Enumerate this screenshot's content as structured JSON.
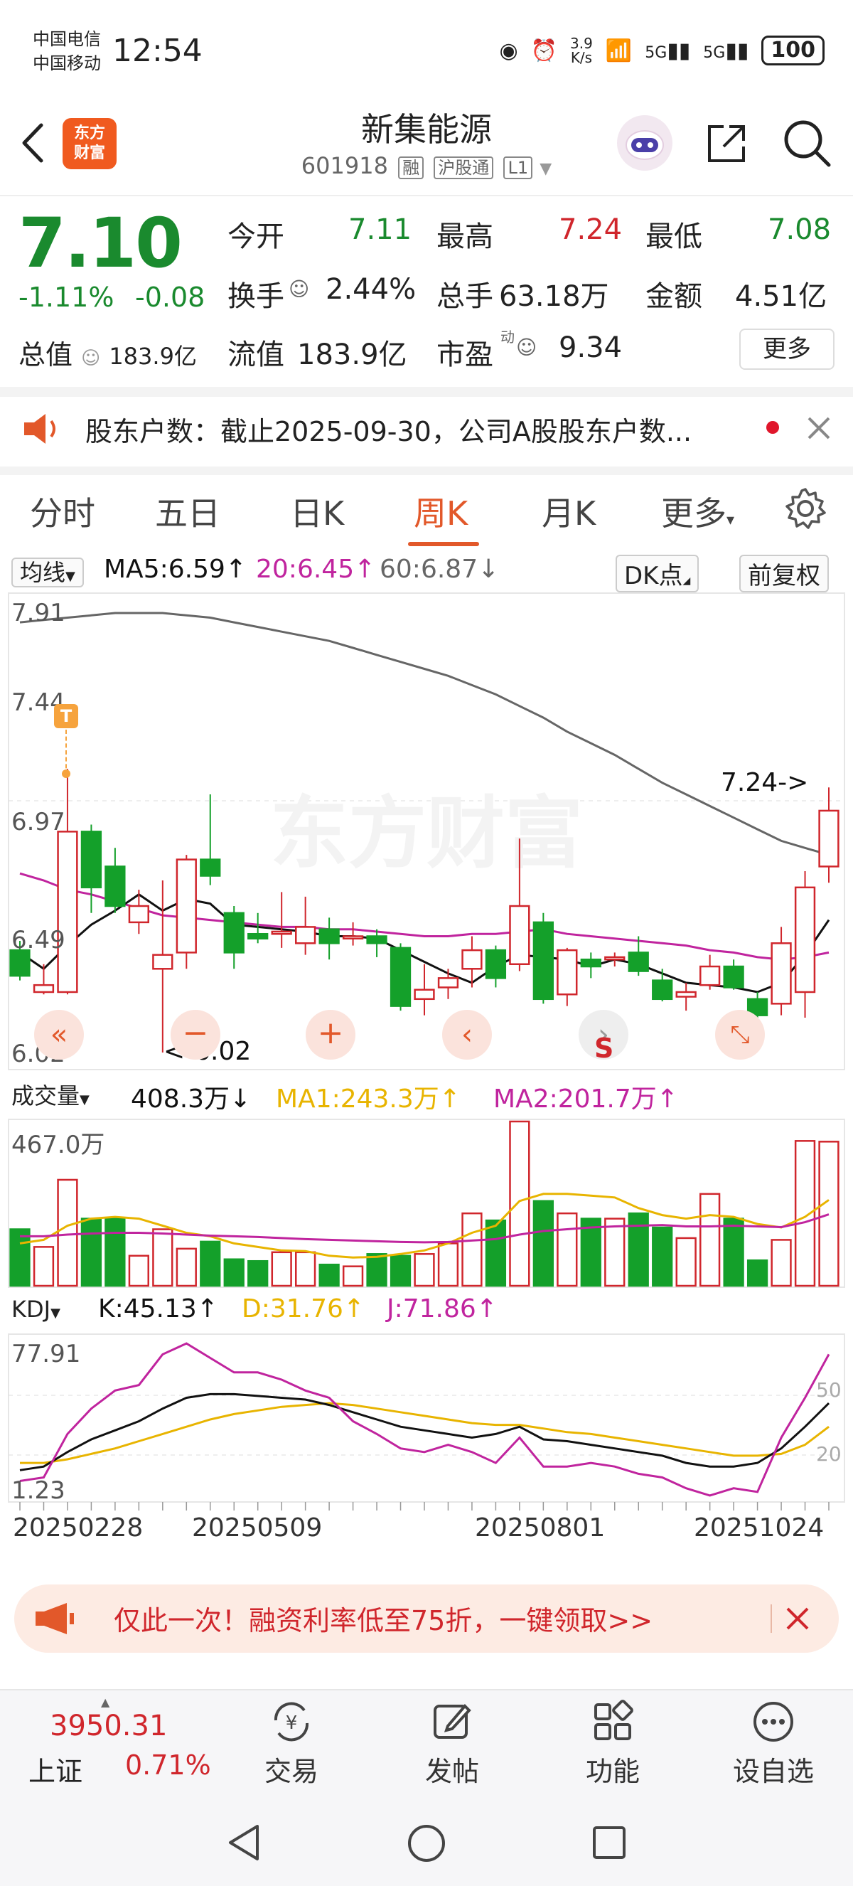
{
  "status_bar": {
    "carrier1": "中国电信",
    "carrier2": "中国移动",
    "time": "12:54",
    "net_speed": "3.9\nK/s",
    "signal1": "5G",
    "signal2": "5G",
    "battery": "100"
  },
  "header": {
    "logo_text": "东方财富",
    "title": "新集能源",
    "code": "601918",
    "tag_margin": "融",
    "tag_connect": "沪股通",
    "tag_level": "L1"
  },
  "quote": {
    "price": "7.10",
    "change_pct": "-1.11%",
    "change_abs": "-0.08",
    "open_label": "今开",
    "open_value": "7.11",
    "high_label": "最高",
    "high_value": "7.24",
    "low_label": "最低",
    "low_value": "7.08",
    "turnover_label": "换手",
    "turnover_value": "2.44%",
    "volume_label": "总手",
    "volume_value": "63.18万",
    "amount_label": "金额",
    "amount_value": "4.51亿",
    "mktcap_label": "总值",
    "mktcap_value": "183.9亿",
    "float_label": "流值",
    "float_value": "183.9亿",
    "pe_label": "市盈",
    "pe_sup": "动",
    "pe_value": "9.34",
    "more": "更多"
  },
  "notice": {
    "text": "股东户数：截止2025-09-30，公司A股股东户数..."
  },
  "tabs": {
    "items": [
      "分时",
      "五日",
      "日K",
      "周K",
      "月K",
      "更多"
    ],
    "active": "周K"
  },
  "kline_legend": {
    "selector": "均线",
    "ma5": "MA5:6.59↑",
    "ma20": "20:6.45↑",
    "ma60": "60:6.87↓",
    "dk_button": "DK点",
    "adjust_button": "前复权"
  },
  "volume_legend": {
    "selector": "成交量",
    "vol": "408.3万↓",
    "ma1": "MA1:243.3万↑",
    "ma2": "MA2:201.7万↑",
    "max_label": "467.0万"
  },
  "kdj_legend": {
    "selector": "KDJ",
    "k": "K:45.13↑",
    "d": "D:31.76↑",
    "j": "J:71.86↑",
    "top_label": "77.91",
    "bottom_label": "1.23",
    "ref50": "50",
    "ref20": "20"
  },
  "price_axis": {
    "labels": [
      "7.91",
      "7.44",
      "6.97",
      "6.49",
      "6.02"
    ],
    "high_marker": "7.24->",
    "low_marker": "<-6.02",
    "t_marker": "T",
    "s_marker": "S"
  },
  "dates": [
    "20250228",
    "20250509",
    "20250801",
    "20251024"
  ],
  "colors": {
    "up": "#d0262c",
    "down": "#14a02a",
    "ma5": "#111111",
    "ma20": "#c0249e",
    "ma60": "#666666",
    "ma_yellow": "#e8b400",
    "accent": "#e2582a"
  },
  "chart_data": {
    "type": "candlestick",
    "ylim": [
      6.02,
      7.91
    ],
    "candles": [
      {
        "o": 6.46,
        "c": 6.35,
        "h": 6.5,
        "l": 6.33
      },
      {
        "o": 6.28,
        "c": 6.31,
        "h": 6.4,
        "l": 6.27
      },
      {
        "o": 6.28,
        "c": 6.97,
        "h": 7.24,
        "l": 6.27
      },
      {
        "o": 6.97,
        "c": 6.73,
        "h": 7.0,
        "l": 6.62
      },
      {
        "o": 6.82,
        "c": 6.65,
        "h": 6.9,
        "l": 6.62
      },
      {
        "o": 6.58,
        "c": 6.65,
        "h": 6.72,
        "l": 6.53
      },
      {
        "o": 6.38,
        "c": 6.44,
        "h": 6.76,
        "l": 6.02
      },
      {
        "o": 6.45,
        "c": 6.85,
        "h": 6.87,
        "l": 6.38
      },
      {
        "o": 6.85,
        "c": 6.78,
        "h": 7.13,
        "l": 6.74
      },
      {
        "o": 6.62,
        "c": 6.45,
        "h": 6.65,
        "l": 6.38
      },
      {
        "o": 6.53,
        "c": 6.51,
        "h": 6.62,
        "l": 6.49
      },
      {
        "o": 6.53,
        "c": 6.54,
        "h": 6.71,
        "l": 6.47
      },
      {
        "o": 6.49,
        "c": 6.56,
        "h": 6.69,
        "l": 6.44
      },
      {
        "o": 6.55,
        "c": 6.49,
        "h": 6.6,
        "l": 6.42
      },
      {
        "o": 6.51,
        "c": 6.52,
        "h": 6.58,
        "l": 6.48
      },
      {
        "o": 6.52,
        "c": 6.49,
        "h": 6.55,
        "l": 6.43
      },
      {
        "o": 6.47,
        "c": 6.22,
        "h": 6.49,
        "l": 6.2
      },
      {
        "o": 6.25,
        "c": 6.29,
        "h": 6.4,
        "l": 6.18
      },
      {
        "o": 6.3,
        "c": 6.34,
        "h": 6.38,
        "l": 6.25
      },
      {
        "o": 6.38,
        "c": 6.46,
        "h": 6.52,
        "l": 6.3
      },
      {
        "o": 6.46,
        "c": 6.34,
        "h": 6.48,
        "l": 6.3
      },
      {
        "o": 6.4,
        "c": 6.65,
        "h": 6.94,
        "l": 6.37
      },
      {
        "o": 6.58,
        "c": 6.25,
        "h": 6.62,
        "l": 6.23
      },
      {
        "o": 6.27,
        "c": 6.46,
        "h": 6.47,
        "l": 6.22
      },
      {
        "o": 6.42,
        "c": 6.39,
        "h": 6.45,
        "l": 6.34
      },
      {
        "o": 6.42,
        "c": 6.43,
        "h": 6.45,
        "l": 6.39
      },
      {
        "o": 6.45,
        "c": 6.37,
        "h": 6.52,
        "l": 6.35
      },
      {
        "o": 6.33,
        "c": 6.25,
        "h": 6.38,
        "l": 6.24
      },
      {
        "o": 6.26,
        "c": 6.28,
        "h": 6.32,
        "l": 6.2
      },
      {
        "o": 6.31,
        "c": 6.39,
        "h": 6.44,
        "l": 6.29
      },
      {
        "o": 6.39,
        "c": 6.3,
        "h": 6.42,
        "l": 6.29
      },
      {
        "o": 6.25,
        "c": 6.18,
        "h": 6.28,
        "l": 6.15
      },
      {
        "o": 6.23,
        "c": 6.49,
        "h": 6.56,
        "l": 6.18
      },
      {
        "o": 6.28,
        "c": 6.73,
        "h": 6.8,
        "l": 6.17
      },
      {
        "o": 6.82,
        "c": 7.06,
        "h": 7.16,
        "l": 6.75
      }
    ],
    "ma5": [
      6.45,
      6.38,
      6.48,
      6.57,
      6.63,
      6.7,
      6.63,
      6.68,
      6.66,
      6.57,
      6.56,
      6.55,
      6.54,
      6.52,
      6.52,
      6.51,
      6.46,
      6.41,
      6.36,
      6.32,
      6.39,
      6.44,
      6.43,
      6.42,
      6.39,
      6.42,
      6.4,
      6.36,
      6.32,
      6.31,
      6.3,
      6.28,
      6.32,
      6.44,
      6.59
    ],
    "ma20": [
      6.79,
      6.76,
      6.72,
      6.7,
      6.67,
      6.64,
      6.61,
      6.6,
      6.59,
      6.58,
      6.57,
      6.56,
      6.56,
      6.55,
      6.55,
      6.54,
      6.53,
      6.52,
      6.52,
      6.53,
      6.53,
      6.54,
      6.55,
      6.53,
      6.52,
      6.51,
      6.5,
      6.49,
      6.48,
      6.46,
      6.45,
      6.43,
      6.42,
      6.43,
      6.45
    ],
    "ma60": [
      7.87,
      7.88,
      7.89,
      7.9,
      7.91,
      7.91,
      7.91,
      7.9,
      7.89,
      7.87,
      7.85,
      7.83,
      7.81,
      7.79,
      7.76,
      7.73,
      7.7,
      7.67,
      7.64,
      7.6,
      7.56,
      7.51,
      7.46,
      7.4,
      7.35,
      7.3,
      7.24,
      7.18,
      7.13,
      7.08,
      7.03,
      6.98,
      6.93,
      6.9,
      6.87
    ],
    "volume_max": 467.0,
    "volume": [
      160,
      110,
      300,
      190,
      190,
      85,
      160,
      105,
      125,
      75,
      70,
      95,
      95,
      60,
      55,
      90,
      85,
      90,
      120,
      205,
      185,
      465,
      240,
      205,
      190,
      190,
      205,
      165,
      135,
      260,
      190,
      72,
      130,
      410,
      408
    ],
    "vol_ma1": [
      120,
      130,
      170,
      190,
      195,
      190,
      170,
      150,
      140,
      120,
      110,
      100,
      98,
      85,
      80,
      82,
      90,
      100,
      120,
      150,
      170,
      240,
      260,
      260,
      255,
      250,
      220,
      200,
      190,
      200,
      195,
      175,
      165,
      195,
      243
    ],
    "vol_ma2": [
      140,
      140,
      145,
      148,
      150,
      150,
      148,
      145,
      142,
      140,
      138,
      135,
      132,
      130,
      128,
      126,
      124,
      123,
      124,
      128,
      132,
      145,
      155,
      160,
      165,
      168,
      170,
      172,
      168,
      168,
      170,
      168,
      166,
      180,
      202
    ],
    "kdj_k": [
      8,
      10,
      18,
      25,
      30,
      35,
      42,
      48,
      50,
      50,
      49,
      48,
      47,
      44,
      40,
      36,
      32,
      30,
      28,
      26,
      28,
      32,
      25,
      24,
      22,
      20,
      18,
      16,
      12,
      10,
      10,
      12,
      20,
      32,
      45
    ],
    "kdj_d": [
      12,
      12,
      14,
      17,
      20,
      24,
      28,
      32,
      36,
      39,
      41,
      43,
      44,
      45,
      44,
      42,
      40,
      38,
      36,
      34,
      33,
      33,
      31,
      29,
      28,
      26,
      24,
      22,
      20,
      18,
      16,
      16,
      17,
      22,
      32
    ],
    "kdj_j": [
      2,
      4,
      28,
      42,
      52,
      55,
      72,
      78,
      70,
      62,
      62,
      58,
      52,
      48,
      35,
      28,
      20,
      18,
      22,
      18,
      12,
      26,
      10,
      10,
      12,
      10,
      6,
      4,
      -2,
      -6,
      -2,
      -4,
      26,
      48,
      72
    ]
  },
  "promo": {
    "text": "仅此一次！融资利率低至75折，一键领取>>"
  },
  "bottom_nav": {
    "index_value": "3950.31",
    "index_name": "上证",
    "index_change": "0.71%",
    "items": [
      "交易",
      "发帖",
      "功能",
      "设自选"
    ]
  }
}
